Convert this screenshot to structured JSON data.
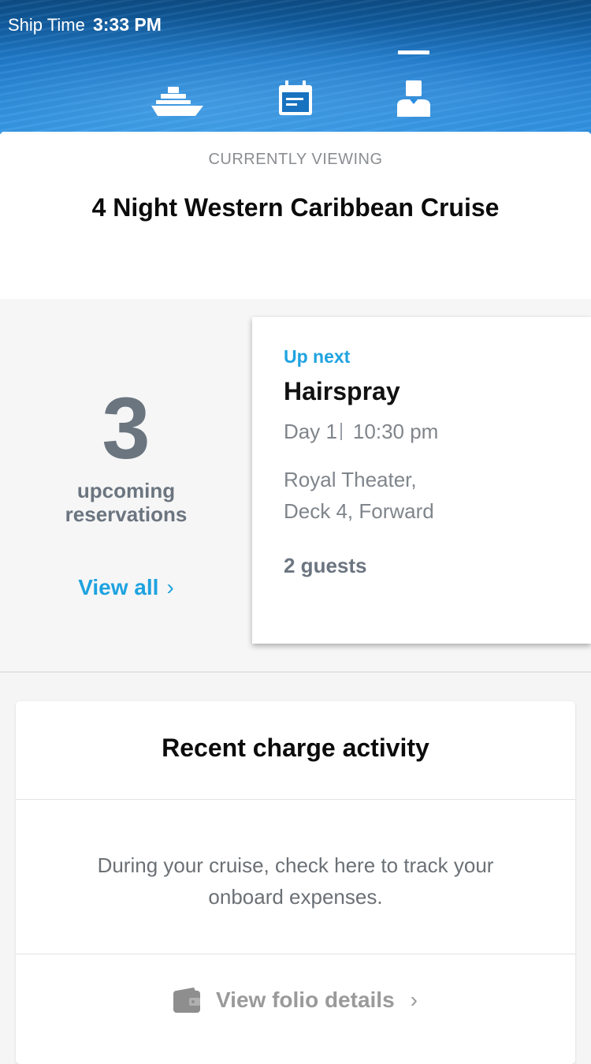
{
  "header": {
    "ship_time_label": "Ship Time",
    "ship_time_value": "3:33 PM",
    "tabs": [
      {
        "icon": "ship-icon",
        "active": false
      },
      {
        "icon": "calendar-icon",
        "active": false
      },
      {
        "icon": "account-icon",
        "active": true
      }
    ]
  },
  "viewing": {
    "label": "CURRENTLY VIEWING",
    "cruise_title": "4 Night Western Caribbean Cruise"
  },
  "reservations": {
    "count": "3",
    "caption_line1": "upcoming",
    "caption_line2": "reservations",
    "view_all_label": "View all",
    "up_next": {
      "label": "Up next",
      "title": "Hairspray",
      "day": "Day 1",
      "time": "10:30 pm",
      "location_line1": "Royal Theater,",
      "location_line2": "Deck 4, Forward",
      "guests": "2 guests"
    }
  },
  "charges": {
    "title": "Recent charge activity",
    "body_line1": "During your cruise, check here to track your",
    "body_line2": "onboard expenses.",
    "folio_label": "View folio details"
  },
  "colors": {
    "accent": "#1ea3e0",
    "muted_text": "#6b7580",
    "header_blue": "#1672c4"
  }
}
